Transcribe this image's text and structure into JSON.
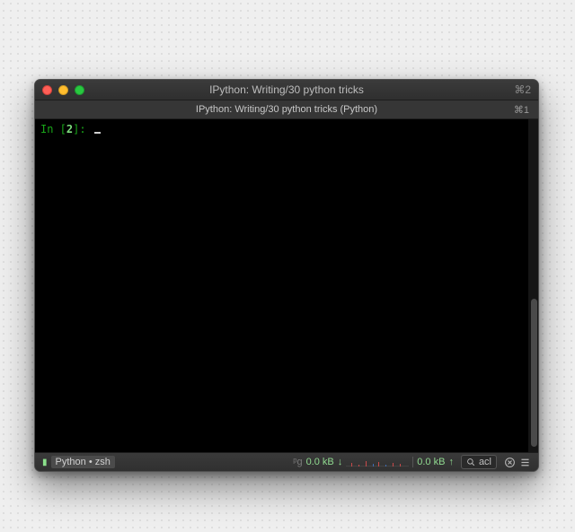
{
  "window": {
    "title": "IPython: Writing/30 python tricks",
    "right_indicator": "⌘2"
  },
  "tab": {
    "label": "IPython: Writing/30 python tricks (Python)",
    "shortcut": "⌘1"
  },
  "terminal": {
    "prompt": {
      "prefix": "In [",
      "num": "2",
      "suffix": "]:"
    },
    "input": ""
  },
  "status": {
    "shell_icon_label": "⬛",
    "shell": "Python • zsh",
    "net": {
      "icon": "ᵖg",
      "down_val": "0.0 kB",
      "down_arrow": "↓",
      "up_val": "0.0 kB",
      "up_arrow": "↑"
    },
    "search": {
      "icon": "search",
      "text": "acl"
    },
    "trailing_icons": [
      "clear-icon",
      "list-icon"
    ]
  }
}
